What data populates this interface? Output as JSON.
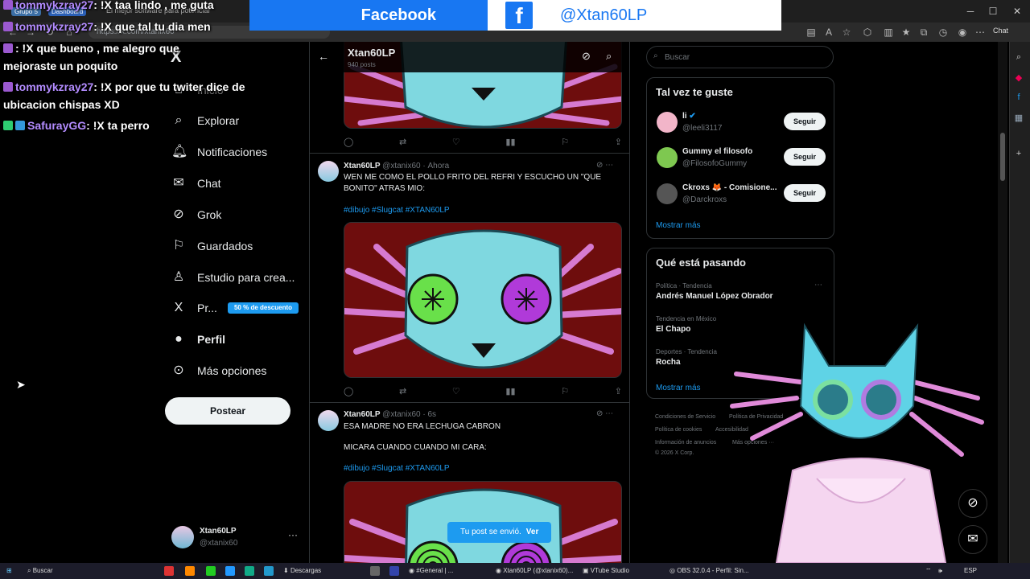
{
  "browser": {
    "tabs": {
      "group": "Grupo 5",
      "dashboard": "Dashboard",
      "tab_text": "El mejor software para potenciar"
    },
    "url": "https://x.com/xtanix60",
    "window_controls": {
      "minimize": "─",
      "maximize": "☐",
      "close": "✕"
    },
    "chat_btn": "Chat"
  },
  "banner": {
    "network": "Facebook",
    "logo": "f",
    "handle": "@Xtan60LP"
  },
  "chat_overlay": [
    {
      "user": "tommykzray27",
      "msg": ": !X taa lindo , me guta"
    },
    {
      "user": "tommykzray27",
      "msg": ": !X que tal tu dia men"
    },
    {
      "user": "",
      "msg": ": !X que bueno , me alegro que"
    },
    {
      "user": "",
      "msg": "mejoraste un poquito"
    },
    {
      "user": "tommykzray27",
      "msg": ": !X por que tu twiter dice de"
    },
    {
      "user": "",
      "msg": "ubicacion chispas XD"
    },
    {
      "user": "SafurayGG",
      "msg": ": !X ta perro"
    }
  ],
  "nav": {
    "logo": "X",
    "items": [
      {
        "label": "Inicio",
        "icon": "home-icon"
      },
      {
        "label": "Explorar",
        "icon": "search-icon"
      },
      {
        "label": "Notificaciones",
        "icon": "bell-icon"
      },
      {
        "label": "Chat",
        "icon": "mail-icon"
      },
      {
        "label": "Grok",
        "icon": "grok-icon"
      },
      {
        "label": "Guardados",
        "icon": "bookmark-icon"
      },
      {
        "label": "Estudio para crea...",
        "icon": "creator-icon"
      },
      {
        "label": "Pr...",
        "icon": "x-premium-icon"
      },
      {
        "label": "Perfil",
        "icon": "person-icon"
      },
      {
        "label": "Más opciones",
        "icon": "more-circle-icon"
      }
    ],
    "premium_badge": "50 % de descuento",
    "post_button": "Postear",
    "account": {
      "name": "Xtan60LP",
      "handle": "@xtanix60",
      "more": "···"
    }
  },
  "timeline": {
    "header": {
      "name": "Xtan60LP",
      "posts": "940 posts"
    },
    "posts": [
      {
        "name": "Xtan60LP",
        "handle": "@xtanix60",
        "time": "Ahora",
        "text": "WEN ME COMO EL POLLO FRITO DEL REFRI Y ESCUCHO UN \"QUE BONITO\" ATRAS MIO:",
        "tags": "#dibujo #Slugcat #XTAN60LP"
      },
      {
        "name": "Xtan60LP",
        "handle": "@xtanix60",
        "time": "6s",
        "text": "ESA MADRE NO ERA LECHUGA CABRON",
        "text2": "MICARA CUANDO CUANDO MI CARA:",
        "tags": "#dibujo #Slugcat #XTAN60LP"
      }
    ],
    "toast": {
      "text": "Tu post se envió.",
      "action": "Ver"
    }
  },
  "right": {
    "search_placeholder": "Buscar",
    "who_to_follow": {
      "title": "Tal vez te guste",
      "items": [
        {
          "name": "li",
          "handle": "@leeli3117",
          "button": "Seguir"
        },
        {
          "name": "Gummy el filosofo",
          "handle": "@FilosofoGummy",
          "button": "Seguir"
        },
        {
          "name": "Ckroxs 🦊 - Comisione...",
          "handle": "@Darckroxs",
          "button": "Seguir"
        }
      ],
      "more": "Mostrar más"
    },
    "trends": {
      "title": "Qué está pasando",
      "items": [
        {
          "category": "Política · Tendencia",
          "name": "Andrés Manuel López Obrador"
        },
        {
          "category": "Tendencia en México",
          "name": "El Chapo"
        },
        {
          "category": "Deportes · Tendencia",
          "name": "Rocha"
        }
      ],
      "more": "Mostrar más"
    },
    "footer": {
      "l1": "Condiciones de Servicio",
      "l2": "Política de Privacidad",
      "l3": "Política de cookies",
      "l4": "Accesibilidad",
      "l5": "Información de anuncios",
      "l6": "Más opciones ···",
      "copy": "© 2026 X Corp."
    }
  },
  "taskbar": {
    "search": "Buscar",
    "descargas": "Descargas",
    "discord": "#General | ...",
    "xtab": "Xtan60LP (@xtanix60)...",
    "vtube": "VTube Studio",
    "obs": "OBS 32.0.4 - Perfil: Sin...",
    "lang": "ESP"
  }
}
